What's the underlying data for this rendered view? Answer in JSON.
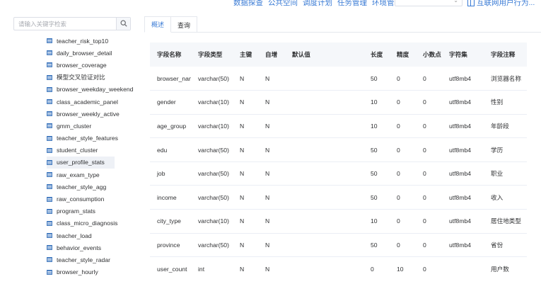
{
  "nav": {
    "links": [
      "数据探查",
      "公共空间",
      "调度计划",
      "任务管理",
      "环境管理"
    ],
    "select_value": "",
    "datasource_label": "互联网用户行为..."
  },
  "search": {
    "placeholder": "请输入关键字检索"
  },
  "tree": {
    "cut_label": "",
    "items": [
      "teacher_risk_top10",
      "daily_browser_detail",
      "browser_coverage",
      "模型交叉验证对比",
      "browser_weekday_weekend",
      "class_academic_panel",
      "browser_weekly_active",
      "gmm_cluster",
      "teacher_style_features",
      "student_cluster",
      "user_profile_stats",
      "raw_exam_type",
      "teacher_style_agg",
      "raw_consumption",
      "program_stats",
      "class_micro_diagnosis",
      "teacher_load",
      "behavior_events",
      "teacher_style_radar",
      "browser_hourly"
    ],
    "selected_index": 10
  },
  "tabs": [
    "概述",
    "查询"
  ],
  "active_tab": 0,
  "table": {
    "headers": [
      "字段名称",
      "字段类型",
      "主键",
      "自增",
      "默认值",
      "长度",
      "精度",
      "小数点",
      "字符集",
      "字段注释"
    ],
    "rows": [
      [
        "browser_name",
        "varchar(50)",
        "N",
        "N",
        "",
        "50",
        "0",
        "0",
        "utf8mb4",
        "浏览器名称"
      ],
      [
        "gender",
        "varchar(10)",
        "N",
        "N",
        "",
        "10",
        "0",
        "0",
        "utf8mb4",
        "性别"
      ],
      [
        "age_group",
        "varchar(10)",
        "N",
        "N",
        "",
        "10",
        "0",
        "0",
        "utf8mb4",
        "年龄段"
      ],
      [
        "edu",
        "varchar(50)",
        "N",
        "N",
        "",
        "50",
        "0",
        "0",
        "utf8mb4",
        "学历"
      ],
      [
        "job",
        "varchar(50)",
        "N",
        "N",
        "",
        "50",
        "0",
        "0",
        "utf8mb4",
        "职业"
      ],
      [
        "income",
        "varchar(50)",
        "N",
        "N",
        "",
        "50",
        "0",
        "0",
        "utf8mb4",
        "收入"
      ],
      [
        "city_type",
        "varchar(10)",
        "N",
        "N",
        "",
        "10",
        "0",
        "0",
        "utf8mb4",
        "居住地类型"
      ],
      [
        "province",
        "varchar(50)",
        "N",
        "N",
        "",
        "50",
        "0",
        "0",
        "utf8mb4",
        "省份"
      ],
      [
        "user_count",
        "int",
        "N",
        "N",
        "",
        "0",
        "10",
        "0",
        "",
        "用户数"
      ]
    ]
  },
  "colors": {
    "accent": "#3a7bd5",
    "header_bg": "#f5f7fa",
    "border": "#ebeef5"
  }
}
